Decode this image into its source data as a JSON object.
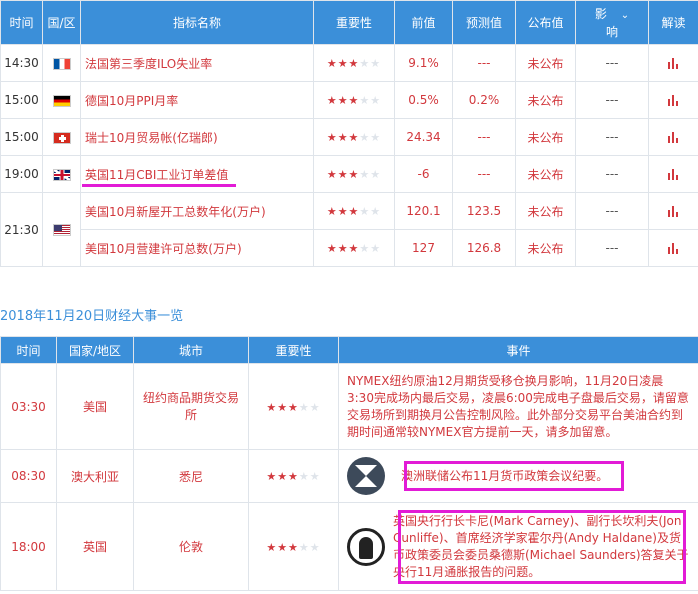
{
  "calendar": {
    "headers": {
      "time": "时间",
      "country": "国/区",
      "indicator": "指标名称",
      "importance": "重要性",
      "previous": "前值",
      "forecast": "预测值",
      "published": "公布值",
      "impact_line1": "影",
      "impact_line2": "响",
      "analysis": "解读"
    },
    "rows": [
      {
        "time": "14:30",
        "flag": "france-flag-icon",
        "indicator": "法国第三季度ILO失业率",
        "stars": 3,
        "previous": "9.1%",
        "forecast": "---",
        "published": "未公布",
        "impact": "---"
      },
      {
        "time": "15:00",
        "flag": "germany-flag-icon",
        "indicator": "德国10月PPI月率",
        "stars": 3,
        "previous": "0.5%",
        "forecast": "0.2%",
        "published": "未公布",
        "impact": "---"
      },
      {
        "time": "15:00",
        "flag": "switzerland-flag-icon",
        "indicator": "瑞士10月贸易帐(亿瑞郎)",
        "stars": 3,
        "previous": "24.34",
        "forecast": "---",
        "published": "未公布",
        "impact": "---"
      },
      {
        "time": "19:00",
        "flag": "uk-flag-icon",
        "indicator": "英国11月CBI工业订单差值",
        "stars": 3,
        "previous": "-6",
        "forecast": "---",
        "published": "未公布",
        "impact": "---"
      },
      {
        "time": "21:30",
        "flag": "us-flag-icon",
        "indicator": "美国10月新屋开工总数年化(万户)",
        "stars": 3,
        "previous": "120.1",
        "forecast": "123.5",
        "published": "未公布",
        "impact": "---"
      },
      {
        "time": "",
        "flag": "",
        "indicator": "美国10月营建许可总数(万户)",
        "stars": 3,
        "previous": "127",
        "forecast": "126.8",
        "published": "未公布",
        "impact": "---"
      }
    ]
  },
  "events_section": {
    "title": "2018年11月20日财经大事一览",
    "headers": {
      "time": "时间",
      "country": "国家/地区",
      "city": "城市",
      "importance": "重要性",
      "event": "事件"
    },
    "rows": [
      {
        "time": "03:30",
        "country": "美国",
        "city": "纽约商品期货交易所",
        "stars": 3,
        "logo": "",
        "event": "NYMEX纽约原油12月期货受移仓换月影响，11月20日凌晨3:30完成场内最后交易，凌晨6:00完成电子盘最后交易，请留意交易场所到期换月公告控制风险。此外部分交易平台美油合约到期时间通常较NYMEX官方提前一天，请多加留意。"
      },
      {
        "time": "08:30",
        "country": "澳大利亚",
        "city": "悉尼",
        "stars": 3,
        "logo": "reserve-bank-australia-logo-icon",
        "event": "澳洲联储公布11月货币政策会议纪要。"
      },
      {
        "time": "18:00",
        "country": "英国",
        "city": "伦敦",
        "stars": 3,
        "logo": "bank-of-england-logo-icon",
        "event": "英国央行行长卡尼(Mark Carney)、副行长坎利夫(Jon Cunliffe)、首席经济学家霍尔丹(Andy Haldane)及货币政策委员会委员桑德斯(Michael Saunders)答复关于央行11月通胀报告的问题。"
      }
    ]
  },
  "colors": {
    "header_bg": "#3b8fd9",
    "accent_red": "#d2383d",
    "highlight_magenta": "#e21bd6"
  }
}
